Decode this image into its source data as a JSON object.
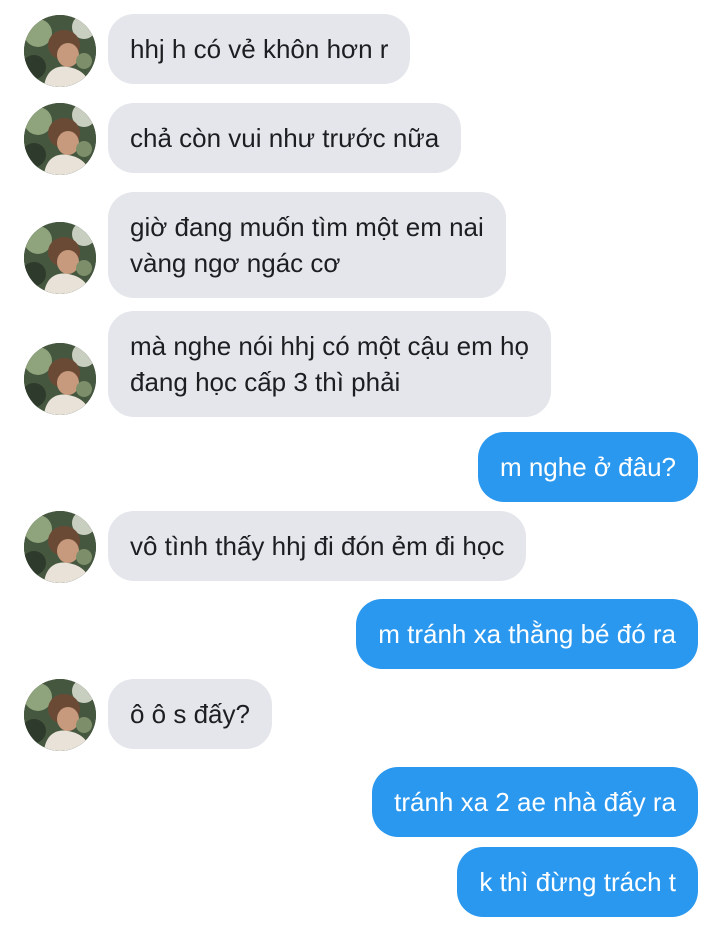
{
  "messages": [
    {
      "direction": "incoming",
      "text": "hhj h có vẻ khôn hơn r"
    },
    {
      "direction": "incoming",
      "text": "chả còn vui như trước nữa"
    },
    {
      "direction": "incoming",
      "text": "giờ đang muốn tìm một em nai\nvàng ngơ ngác cơ"
    },
    {
      "direction": "incoming",
      "text": "mà nghe nói hhj có một cậu em họ\nđang học cấp 3 thì phải"
    },
    {
      "direction": "outgoing",
      "text": "m nghe ở đâu?"
    },
    {
      "direction": "incoming",
      "text": "vô tình thấy hhj đi đón ẻm  đi học"
    },
    {
      "direction": "outgoing",
      "text": "m tránh xa thằng bé đó ra"
    },
    {
      "direction": "incoming",
      "text": "ô ô s đấy?"
    },
    {
      "direction": "outgoing",
      "text": "tránh xa 2 ae nhà đấy ra"
    },
    {
      "direction": "outgoing",
      "text": "k thì đừng trách t"
    }
  ],
  "colors": {
    "incoming_bubble": "#e4e6eb",
    "outgoing_bubble": "#2b98ef",
    "outgoing_text": "#ffffff",
    "incoming_text": "#1c1e21"
  },
  "icons": {
    "avatar": "contact-avatar-photo"
  }
}
